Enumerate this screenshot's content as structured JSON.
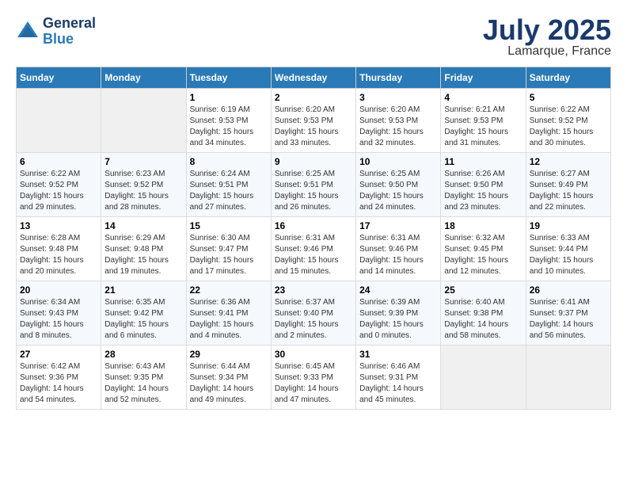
{
  "logo": {
    "line1": "General",
    "line2": "Blue"
  },
  "title": "July 2025",
  "subtitle": "Lamarque, France",
  "headers": [
    "Sunday",
    "Monday",
    "Tuesday",
    "Wednesday",
    "Thursday",
    "Friday",
    "Saturday"
  ],
  "weeks": [
    [
      {
        "day": "",
        "info": ""
      },
      {
        "day": "",
        "info": ""
      },
      {
        "day": "1",
        "info": "Sunrise: 6:19 AM\nSunset: 9:53 PM\nDaylight: 15 hours and 34 minutes."
      },
      {
        "day": "2",
        "info": "Sunrise: 6:20 AM\nSunset: 9:53 PM\nDaylight: 15 hours and 33 minutes."
      },
      {
        "day": "3",
        "info": "Sunrise: 6:20 AM\nSunset: 9:53 PM\nDaylight: 15 hours and 32 minutes."
      },
      {
        "day": "4",
        "info": "Sunrise: 6:21 AM\nSunset: 9:53 PM\nDaylight: 15 hours and 31 minutes."
      },
      {
        "day": "5",
        "info": "Sunrise: 6:22 AM\nSunset: 9:52 PM\nDaylight: 15 hours and 30 minutes."
      }
    ],
    [
      {
        "day": "6",
        "info": "Sunrise: 6:22 AM\nSunset: 9:52 PM\nDaylight: 15 hours and 29 minutes."
      },
      {
        "day": "7",
        "info": "Sunrise: 6:23 AM\nSunset: 9:52 PM\nDaylight: 15 hours and 28 minutes."
      },
      {
        "day": "8",
        "info": "Sunrise: 6:24 AM\nSunset: 9:51 PM\nDaylight: 15 hours and 27 minutes."
      },
      {
        "day": "9",
        "info": "Sunrise: 6:25 AM\nSunset: 9:51 PM\nDaylight: 15 hours and 26 minutes."
      },
      {
        "day": "10",
        "info": "Sunrise: 6:25 AM\nSunset: 9:50 PM\nDaylight: 15 hours and 24 minutes."
      },
      {
        "day": "11",
        "info": "Sunrise: 6:26 AM\nSunset: 9:50 PM\nDaylight: 15 hours and 23 minutes."
      },
      {
        "day": "12",
        "info": "Sunrise: 6:27 AM\nSunset: 9:49 PM\nDaylight: 15 hours and 22 minutes."
      }
    ],
    [
      {
        "day": "13",
        "info": "Sunrise: 6:28 AM\nSunset: 9:48 PM\nDaylight: 15 hours and 20 minutes."
      },
      {
        "day": "14",
        "info": "Sunrise: 6:29 AM\nSunset: 9:48 PM\nDaylight: 15 hours and 19 minutes."
      },
      {
        "day": "15",
        "info": "Sunrise: 6:30 AM\nSunset: 9:47 PM\nDaylight: 15 hours and 17 minutes."
      },
      {
        "day": "16",
        "info": "Sunrise: 6:31 AM\nSunset: 9:46 PM\nDaylight: 15 hours and 15 minutes."
      },
      {
        "day": "17",
        "info": "Sunrise: 6:31 AM\nSunset: 9:46 PM\nDaylight: 15 hours and 14 minutes."
      },
      {
        "day": "18",
        "info": "Sunrise: 6:32 AM\nSunset: 9:45 PM\nDaylight: 15 hours and 12 minutes."
      },
      {
        "day": "19",
        "info": "Sunrise: 6:33 AM\nSunset: 9:44 PM\nDaylight: 15 hours and 10 minutes."
      }
    ],
    [
      {
        "day": "20",
        "info": "Sunrise: 6:34 AM\nSunset: 9:43 PM\nDaylight: 15 hours and 8 minutes."
      },
      {
        "day": "21",
        "info": "Sunrise: 6:35 AM\nSunset: 9:42 PM\nDaylight: 15 hours and 6 minutes."
      },
      {
        "day": "22",
        "info": "Sunrise: 6:36 AM\nSunset: 9:41 PM\nDaylight: 15 hours and 4 minutes."
      },
      {
        "day": "23",
        "info": "Sunrise: 6:37 AM\nSunset: 9:40 PM\nDaylight: 15 hours and 2 minutes."
      },
      {
        "day": "24",
        "info": "Sunrise: 6:39 AM\nSunset: 9:39 PM\nDaylight: 15 hours and 0 minutes."
      },
      {
        "day": "25",
        "info": "Sunrise: 6:40 AM\nSunset: 9:38 PM\nDaylight: 14 hours and 58 minutes."
      },
      {
        "day": "26",
        "info": "Sunrise: 6:41 AM\nSunset: 9:37 PM\nDaylight: 14 hours and 56 minutes."
      }
    ],
    [
      {
        "day": "27",
        "info": "Sunrise: 6:42 AM\nSunset: 9:36 PM\nDaylight: 14 hours and 54 minutes."
      },
      {
        "day": "28",
        "info": "Sunrise: 6:43 AM\nSunset: 9:35 PM\nDaylight: 14 hours and 52 minutes."
      },
      {
        "day": "29",
        "info": "Sunrise: 6:44 AM\nSunset: 9:34 PM\nDaylight: 14 hours and 49 minutes."
      },
      {
        "day": "30",
        "info": "Sunrise: 6:45 AM\nSunset: 9:33 PM\nDaylight: 14 hours and 47 minutes."
      },
      {
        "day": "31",
        "info": "Sunrise: 6:46 AM\nSunset: 9:31 PM\nDaylight: 14 hours and 45 minutes."
      },
      {
        "day": "",
        "info": ""
      },
      {
        "day": "",
        "info": ""
      }
    ]
  ]
}
